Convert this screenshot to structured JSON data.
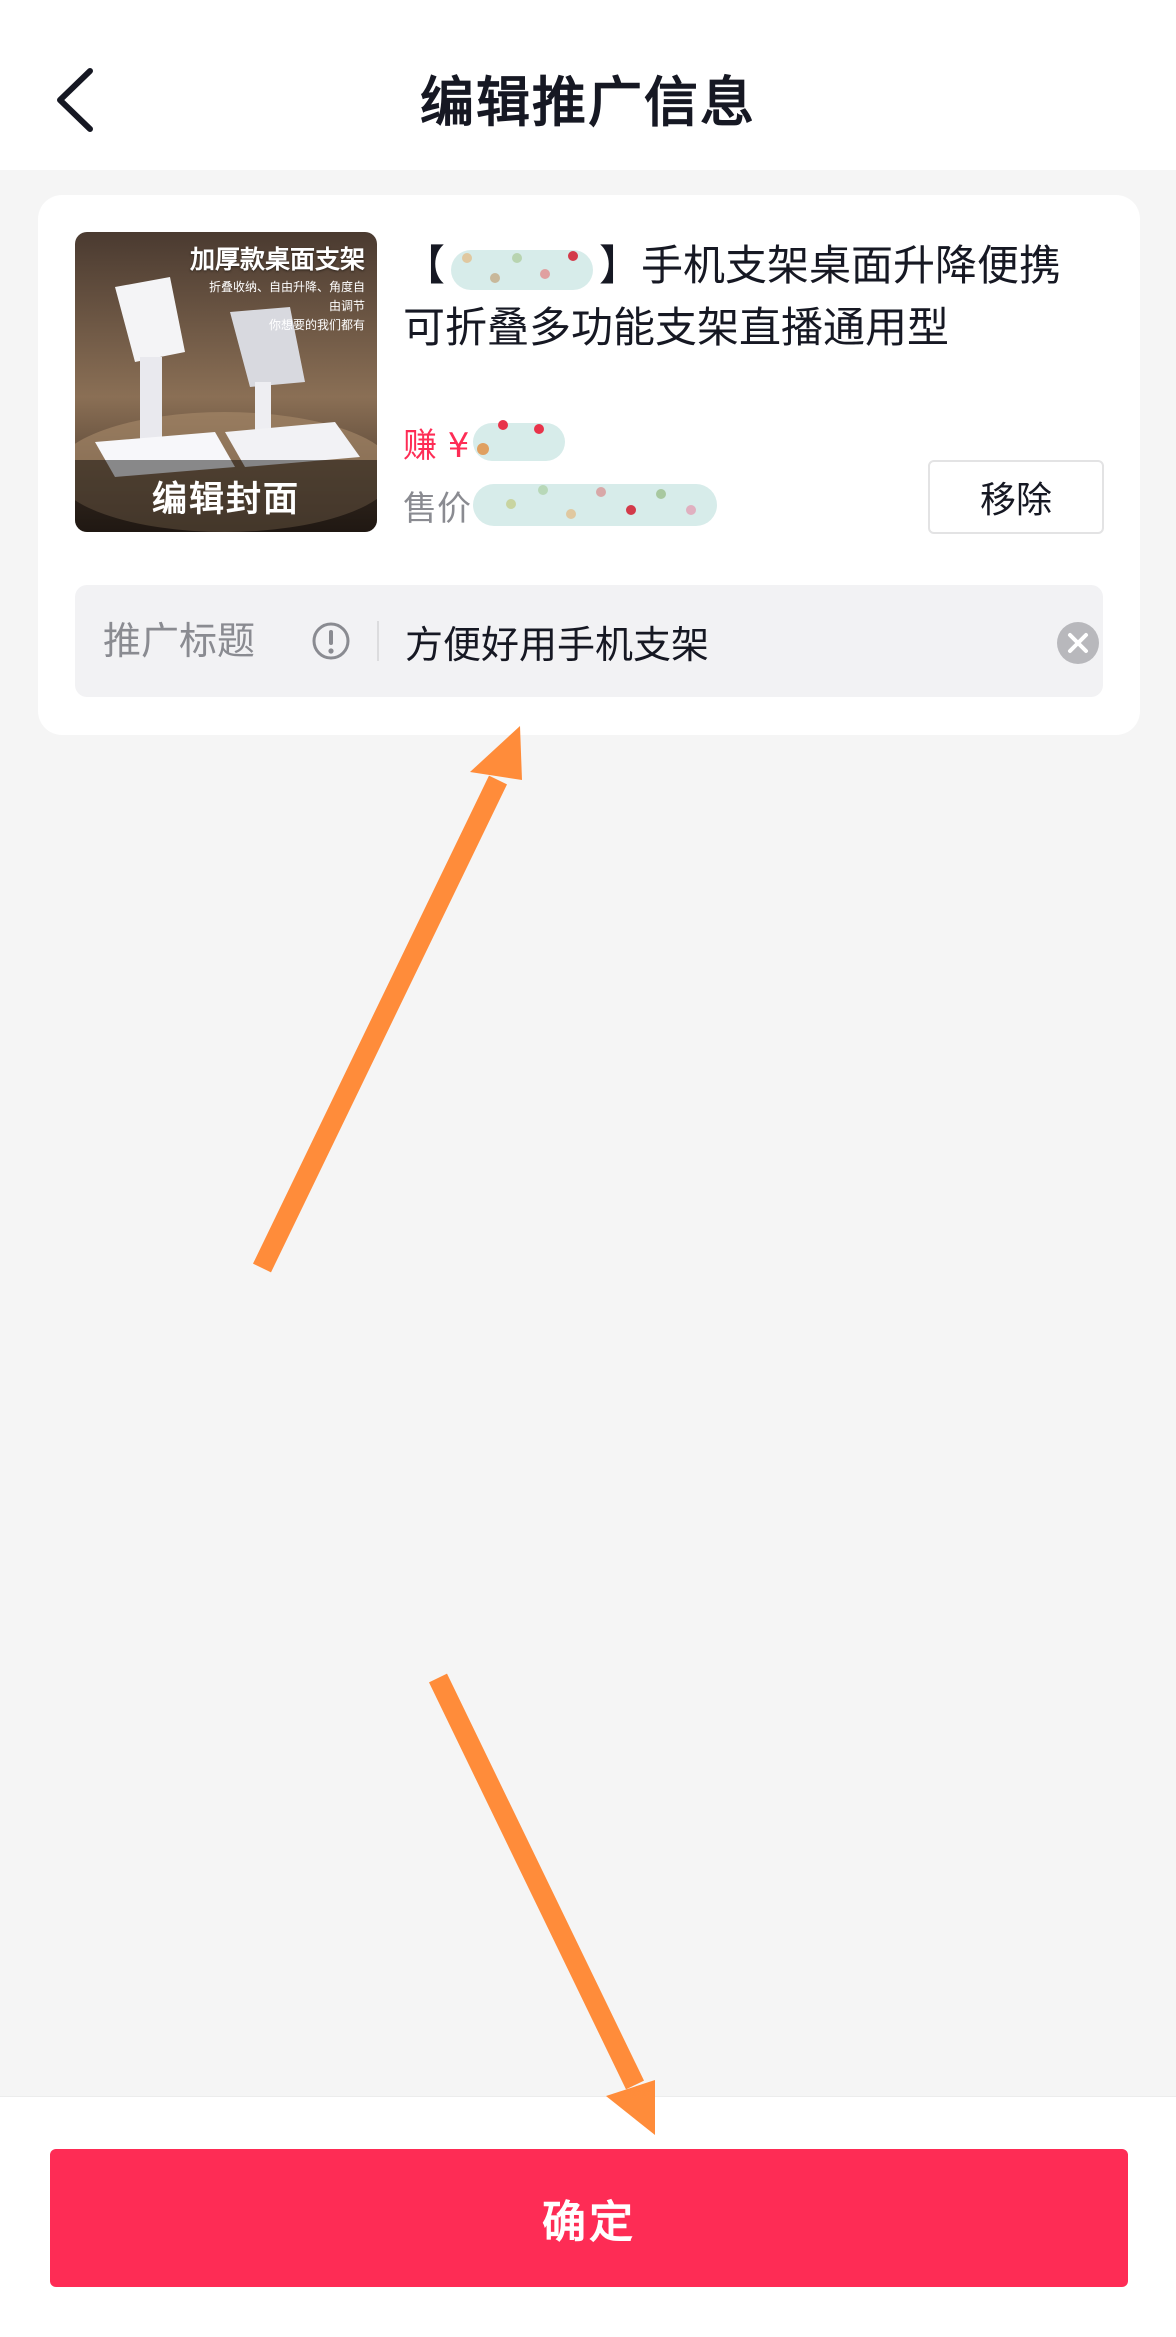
{
  "header": {
    "title": "编辑推广信息",
    "back_icon": "chevron-left-icon"
  },
  "product": {
    "cover": {
      "headline": "加厚款桌面支架",
      "subline1": "折叠收纳、自由升降、角度自由调节",
      "subline2": "你想要的我们都有",
      "edit_label": "编辑封面"
    },
    "title_prefix": "【",
    "title_suffix": "】手机支架桌面升降便携可折叠多功能支架直播通用型",
    "earn_label": "赚 ¥",
    "price_label": "售价",
    "remove_label": "移除"
  },
  "promo": {
    "label": "推广标题",
    "value": "方便好用手机支架",
    "info_icon": "exclamation-circle-icon",
    "clear_icon": "clear-circle-icon"
  },
  "footer": {
    "confirm_label": "确定"
  },
  "colors": {
    "accent": "#fe2c55",
    "annotation_arrow": "#ff8c3a",
    "background": "#f5f5f5"
  }
}
